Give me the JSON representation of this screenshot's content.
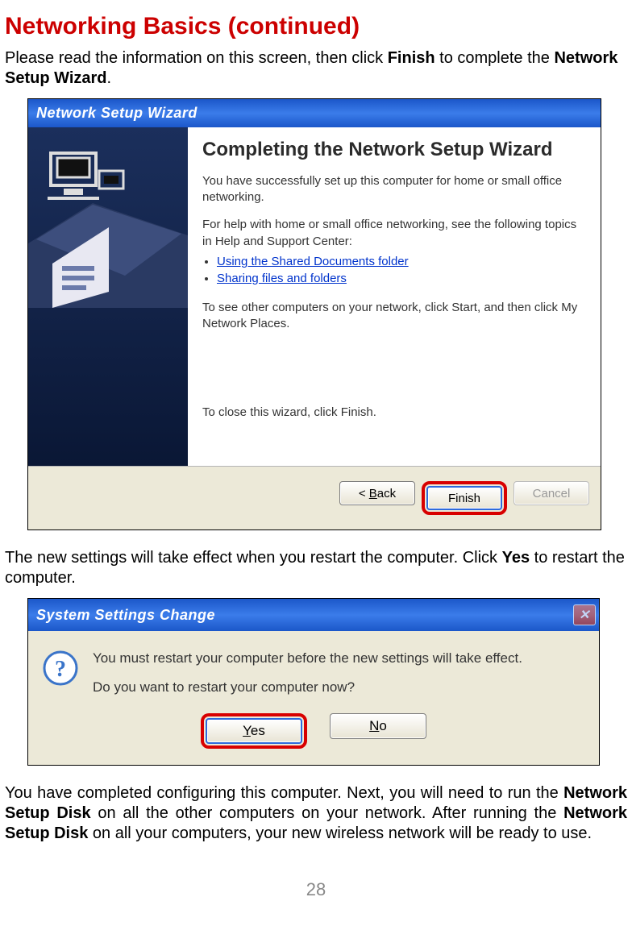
{
  "page": {
    "title": "Networking Basics (continued)",
    "intro_pre": "Please read the information on this screen, then click ",
    "intro_bold": "Finish",
    "intro_mid": " to complete the ",
    "intro_bold2": "Network Setup Wizard",
    "intro_post": ".",
    "after_wizard_pre": "The new settings will take effect when you restart the computer. Click ",
    "after_wizard_bold": "Yes",
    "after_wizard_post": " to restart the computer.",
    "final_pre": "You have completed configuring this computer. Next, you will need to run the ",
    "final_bold1": "Network Setup Disk",
    "final_mid": " on all the other computers on your network. After running the ",
    "final_bold2": "Network Setup Disk",
    "final_post": " on all your computers, your new wireless network will be ready to use.",
    "page_number": "28"
  },
  "wizard": {
    "titlebar": "Network Setup Wizard",
    "heading": "Completing the Network Setup Wizard",
    "p1": "You have successfully set up this computer for home or small office networking.",
    "p2": "For help with home or small office networking, see the following topics in Help and Support Center:",
    "link1": "Using the Shared Documents folder",
    "link2": "Sharing files and folders",
    "p3": "To see other computers on your network, click Start, and then click My Network Places.",
    "p4": "To close this wizard, click Finish.",
    "btn_back": "< Back",
    "btn_finish": "Finish",
    "btn_cancel": "Cancel"
  },
  "restart_dialog": {
    "titlebar": "System Settings Change",
    "line1": "You must restart your computer before the new settings will take effect.",
    "line2": "Do you want to restart your computer now?",
    "btn_yes": "Yes",
    "btn_no": "No"
  }
}
